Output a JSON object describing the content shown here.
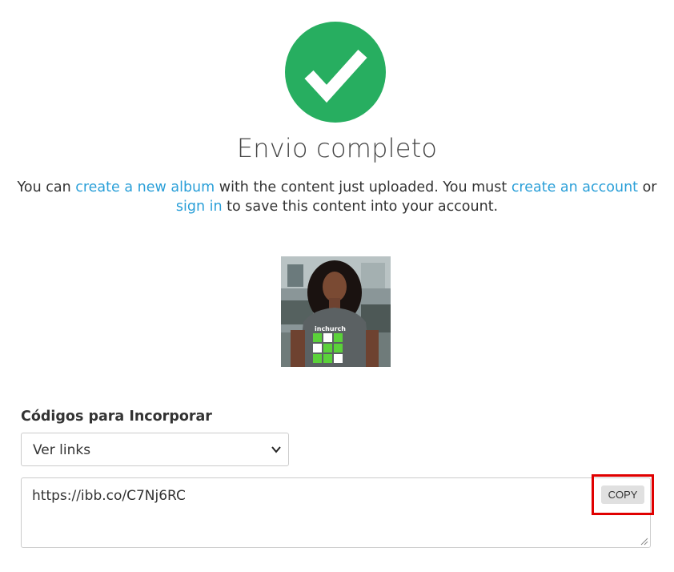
{
  "status": {
    "icon": "check-circle-icon",
    "color": "#27ae60",
    "title": "Envio completo"
  },
  "message": {
    "prefix": "You can ",
    "link_new_album": "create a new album",
    "middle": " with the content just uploaded. You must ",
    "link_create_account": "create an account",
    "or": " or ",
    "link_sign_in": "sign in",
    "suffix": " to save this content into your account."
  },
  "uploaded_image": {
    "alt": "uploaded-photo-thumbnail",
    "shirt_text": "inchurch"
  },
  "embed": {
    "label": "Códigos para Incorporar",
    "select_value": "Ver links",
    "code": "https://ibb.co/C7Nj6RC",
    "copy_label": "COPY"
  },
  "colors": {
    "link": "#2a9fd8",
    "success": "#27ae60",
    "highlight": "#e00000"
  }
}
